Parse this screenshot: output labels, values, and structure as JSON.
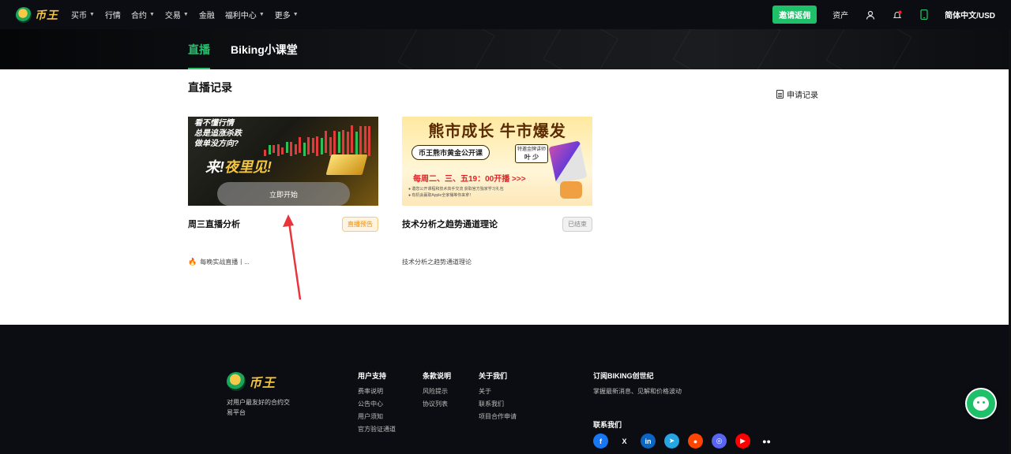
{
  "nav": {
    "brand": "币王",
    "items": [
      {
        "label": "买币",
        "caret": true
      },
      {
        "label": "行情",
        "caret": false
      },
      {
        "label": "合约",
        "caret": true
      },
      {
        "label": "交易",
        "caret": true
      },
      {
        "label": "金融",
        "caret": false
      },
      {
        "label": "福利中心",
        "caret": true
      },
      {
        "label": "更多",
        "caret": true
      }
    ],
    "invite": "邀请返佣",
    "assets": "资产",
    "language": "简体中文/USD"
  },
  "tabs": {
    "live": "直播",
    "course": "Biking小课堂"
  },
  "main": {
    "title": "直播记录",
    "apply_record": "申请记录"
  },
  "cards": [
    {
      "title": "周三直播分析",
      "badge": "直播预告",
      "desc": "每晚实战直播丨...",
      "start_button": "立即开始",
      "thumb_lines": [
        "看不懂行情",
        "总是追涨杀跌",
        "做单没方向?"
      ],
      "thumb_big_a": "来!",
      "thumb_big_b": "夜里见!"
    },
    {
      "title": "技术分析之趋势通道理论",
      "badge": "已结束",
      "desc": "技术分析之趋势通道理论",
      "thumb_head": "熊市成长 牛市爆发",
      "thumb_badge": "币王熊市黄金公开课",
      "thumb_tag_a": "特邀金牌讲师",
      "thumb_tag_b": "叶 少",
      "thumb_time": "每周二、三、五19：00开播 >>>",
      "thumb_small_a": "● 邀您公开课程和技术高手交流 获取官方独家学习礼包",
      "thumb_small_b": "● 有机会赢取Apple全家桶等你来拿！"
    }
  ],
  "footer": {
    "slogan": "对用户最友好的合约交易平台",
    "cols": [
      {
        "head": "用户支持",
        "items": [
          "费率说明",
          "公告中心",
          "用户须知",
          "官方验证通道"
        ]
      },
      {
        "head": "条款说明",
        "items": [
          "风险提示",
          "协议列表"
        ]
      },
      {
        "head": "关于我们",
        "items": [
          "关于",
          "联系我们",
          "项目合作申请"
        ]
      }
    ],
    "subscribe_head": "订阅BIKING创世纪",
    "subscribe_desc": "掌握最新消息、见解和价格波动",
    "contact_head": "联系我们",
    "socials": [
      {
        "name": "facebook-icon",
        "glyph": "f",
        "color": "#1877f2"
      },
      {
        "name": "x-icon",
        "glyph": "X",
        "color": "#0b0d12"
      },
      {
        "name": "linkedin-icon",
        "glyph": "in",
        "color": "#0a66c2"
      },
      {
        "name": "telegram-icon",
        "glyph": "➤",
        "color": "#26a5e4"
      },
      {
        "name": "reddit-icon",
        "glyph": "●",
        "color": "#ff4500"
      },
      {
        "name": "discord-icon",
        "glyph": "◎",
        "color": "#5865f2"
      },
      {
        "name": "youtube-icon",
        "glyph": "▶",
        "color": "#ff0000"
      },
      {
        "name": "medium-icon",
        "glyph": "●●",
        "color": "#0b0d12"
      }
    ]
  },
  "colors": {
    "accent": "#25c26e",
    "invite": "#1fc06a",
    "preview": "#f08a00"
  }
}
